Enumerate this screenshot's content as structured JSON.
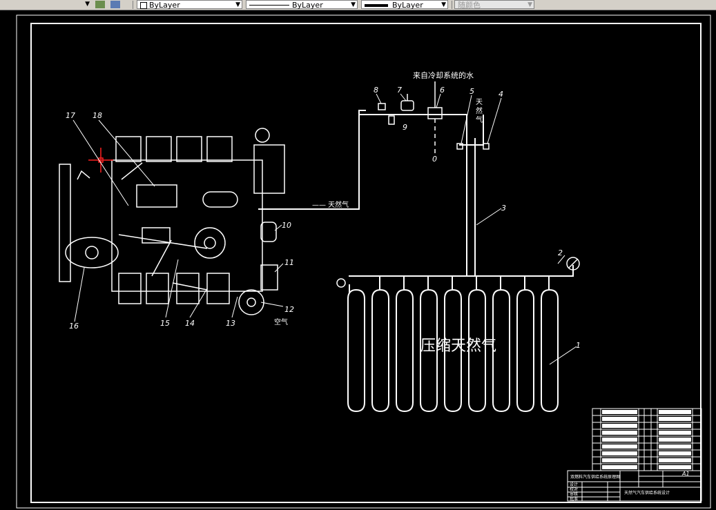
{
  "toolbar": {
    "layer_prop": "ByLayer",
    "linetype": "ByLayer",
    "lineweight": "ByLayer",
    "plot_style": "随颜色"
  },
  "drawing": {
    "labels": {
      "n1": "1",
      "n2": "2",
      "n3": "3",
      "n4": "4",
      "n5": "5",
      "n6": "6",
      "n7": "7",
      "n8": "8",
      "n9": "9",
      "n10": "10",
      "n11": "11",
      "n12": "12",
      "n13": "13",
      "n14": "14",
      "n15": "15",
      "n16": "16",
      "n17": "17",
      "n18": "18",
      "drain": "0"
    },
    "annotations": {
      "coolant": "来自冷却系统的水",
      "natural_gas_vertical": "天 然 气",
      "natural_gas_pipe": "—— 天然气",
      "air": "空气",
      "cng": "压缩天然气"
    },
    "title_block": {
      "sheet_size": "A1",
      "rows": [
        "双燃料汽车供给系统原理图",
        "设计",
        "校对",
        "审核",
        "批准"
      ],
      "drawing_title": "天然气汽车供给系统设计"
    }
  }
}
